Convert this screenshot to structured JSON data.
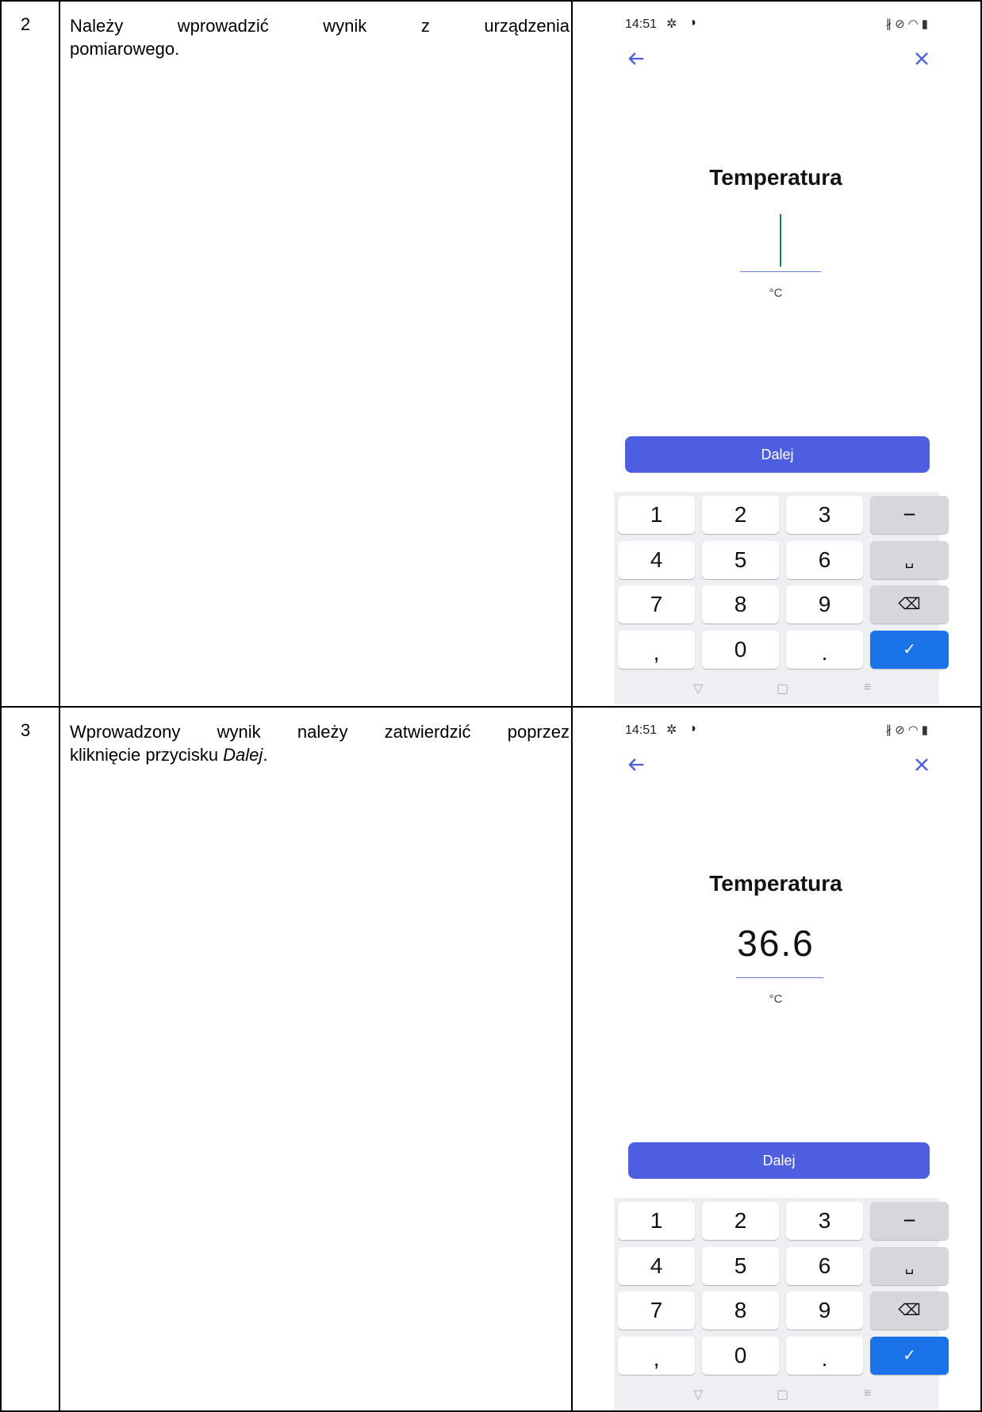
{
  "rows": [
    {
      "number": "2",
      "description_line1": "Należy wprowadzić wynik z urządzenia",
      "description_line2": "pomiarowego.",
      "screen": {
        "time": "14:51",
        "title": "Temperatura",
        "value": "",
        "unit": "°C",
        "next_label": "Dalej"
      }
    },
    {
      "number": "3",
      "description_line1": "Wprowadzony wynik należy zatwierdzić poprzez",
      "description_line2_prefix": "kliknięcie przycisku ",
      "description_line2_em": "Dalej",
      "description_line2_suffix": ".",
      "screen": {
        "time": "14:51",
        "title": "Temperatura",
        "value": "36.6",
        "unit": "°C",
        "next_label": "Dalej"
      }
    }
  ],
  "keypad": {
    "keys": [
      "1",
      "2",
      "3",
      "−",
      "4",
      "5",
      "6",
      "␣",
      "7",
      "8",
      "9",
      "⌫",
      ",",
      "0",
      ".",
      "✓"
    ]
  },
  "icons": {
    "back": "arrow-left-icon",
    "close": "close-icon",
    "settings": "gear-icon",
    "status": "sync-icon",
    "bluetooth": "bluetooth-icon",
    "mute": "mute-icon",
    "wifi": "wifi-icon",
    "battery": "battery-icon"
  },
  "colors": {
    "accent": "#4d5fe0",
    "confirm_key": "#1a73e8",
    "cursor": "#1a7f5a"
  }
}
